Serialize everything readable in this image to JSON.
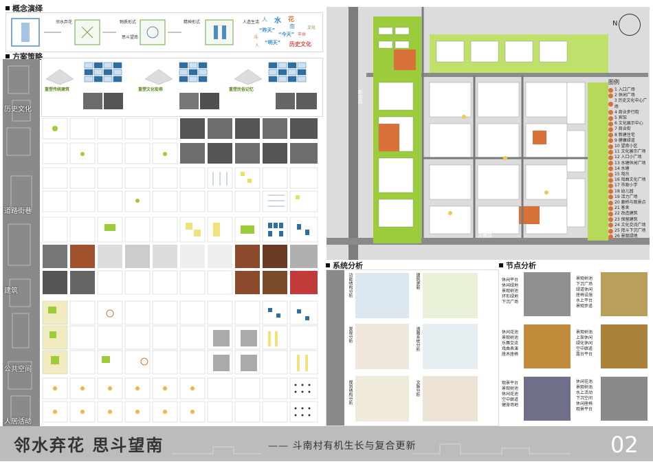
{
  "sections": {
    "concept": "概念演绎",
    "strategy": "方案策略",
    "system": "系统分析",
    "node": "节点分析"
  },
  "concept": {
    "items": [
      "邻水弃花",
      "物质形式",
      "思斗望南",
      "精神形式",
      "人造生活"
    ],
    "word_cloud": [
      "人",
      "水",
      "花",
      "南",
      "“昨天”",
      "“今天”",
      "“明天”",
      "斗",
      "市井",
      "文化",
      "人",
      "历史文化"
    ]
  },
  "strategy_rows": [
    {
      "label": "历史文化",
      "notes": [
        "重塑传统建筑",
        "重塑文化街巷",
        "重塑民俗记忆"
      ]
    },
    {
      "label": "道路街巷",
      "notes": []
    },
    {
      "label": "建筑",
      "notes": []
    },
    {
      "label": "公共空间",
      "notes": []
    },
    {
      "label": "人居活动",
      "notes": []
    }
  ],
  "map": {
    "road_label": "井南路",
    "road_label_left": "新南路",
    "legend_title": "图例",
    "legend": [
      "1 入口广场",
      "2 休闲广场",
      "3 历史文化中心广场",
      "4 商业步行街",
      "5 宾馆",
      "6 文化展示中心",
      "7 商业街",
      "8 新建住宅",
      "9 健康绿道",
      "10 望南小区",
      "11 文化展示广场",
      "12 入口小广场",
      "13 水塘休闲广场",
      "14 水塘",
      "15 戏台",
      "16 戏曲文化广场",
      "17 市政小学",
      "18 幼儿园",
      "19 活力广场",
      "20 廊桥与观景点",
      "21 客舍",
      "22 改造建筑",
      "23 保留建筑",
      "24 文化交流广场",
      "25 拜斗下沉广场",
      "26 景观绿地"
    ],
    "north": "N"
  },
  "system": {
    "items": [
      "功能结构分析",
      "建筑更新",
      "景观分析",
      "道路系统分析",
      "规划结构分析",
      "文脉分析"
    ]
  },
  "node": {
    "texts": [
      [
        "休闲平台",
        "休闲绿地",
        "景观树池",
        "环形绿地",
        "下沉广场"
      ],
      [
        "景观树池",
        "下沉广场",
        "绿道休闲",
        "座椅设施",
        "水上平台",
        "景观步道"
      ],
      [
        "休闲花池",
        "景观树池",
        "乐舞交流",
        "戏曲表演",
        "座木座椅"
      ],
      [
        "景观树池",
        "上架休闲",
        "绿化休闲",
        "空中廊道",
        "露台平台"
      ],
      [
        "观景平台",
        "景观树池",
        "休闲花池",
        "空中廊道",
        "健身场地"
      ],
      [
        "休闲花池",
        "景观树池",
        "水上活动",
        "下沉空间",
        "休闲座椅",
        "观景平台"
      ]
    ]
  },
  "banner": {
    "title": "邻水弃花 思斗望南",
    "subtitle": "—— 斗南村有机生长与复合更新",
    "page": "02"
  },
  "colors": {
    "green": "#9ccc3c",
    "orange": "#d9713a",
    "blue": "#2f6f9f",
    "gray": "#8a8a8a"
  }
}
